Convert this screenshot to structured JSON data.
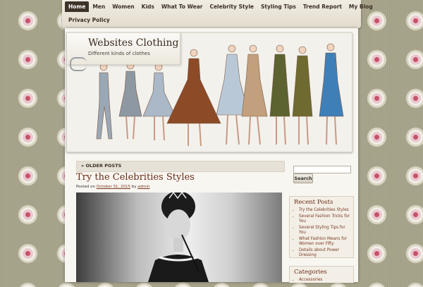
{
  "nav": {
    "items": [
      {
        "label": "Home"
      },
      {
        "label": "Men"
      },
      {
        "label": "Women"
      },
      {
        "label": "Kids"
      },
      {
        "label": "What To Wear"
      },
      {
        "label": "Celebrity Style"
      },
      {
        "label": "Styling Tips"
      },
      {
        "label": "Trend Report"
      },
      {
        "label": "My Blog"
      },
      {
        "label": "Privacy Policy"
      }
    ]
  },
  "header": {
    "site_title": "Websites Clothing",
    "site_description": "Different kinds of clothes"
  },
  "main": {
    "older_posts_label": "« OLDER POSTS",
    "post": {
      "title": "Try the Celebrities Styles",
      "posted_on_text": "Posted on",
      "date": "October 31, 2015",
      "by_text": "by",
      "author": "admin"
    }
  },
  "sidebar": {
    "search_button_label": "Search",
    "recent_posts": {
      "heading": "Recent Posts",
      "items": [
        "Try the Celebrities Styles",
        "Several Fashion Tricks for You",
        "Several Styling Tips for You",
        "What Fashion Means for Women over Fifty",
        "Details about Power Dressing"
      ]
    },
    "categories": {
      "heading": "Categories",
      "items": [
        "Accessories"
      ]
    }
  },
  "colors": {
    "accent": "#6b2a16",
    "nav_active": "#3e3328",
    "link": "#7a3a22"
  }
}
